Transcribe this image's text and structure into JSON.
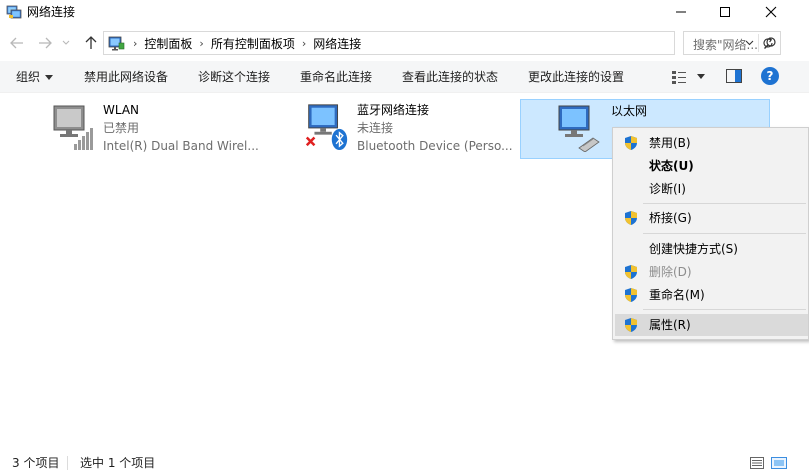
{
  "window": {
    "title": "网络连接"
  },
  "address": {
    "crumbs": [
      "控制面板",
      "所有控制面板项",
      "网络连接"
    ],
    "search_placeholder": "搜索\"网络..."
  },
  "commands": {
    "organize": "组织",
    "disable_device": "禁用此网络设备",
    "diagnose": "诊断这个连接",
    "rename": "重命名此连接",
    "view_status": "查看此连接的状态",
    "change_settings": "更改此连接的设置",
    "help_glyph": "?"
  },
  "connections": [
    {
      "name": "WLAN",
      "status": "已禁用",
      "device": "Intel(R) Dual Band Wirel...",
      "icon": "wifi-adapter-icon"
    },
    {
      "name": "蓝牙网络连接",
      "status": "未连接",
      "device": "Bluetooth Device (Perso...",
      "icon": "bluetooth-adapter-icon"
    },
    {
      "name": "以太网",
      "status": "",
      "device": "",
      "icon": "ethernet-adapter-icon",
      "selected": true
    }
  ],
  "context_menu": [
    {
      "label": "禁用(B)",
      "shield": true
    },
    {
      "label": "状态(U)",
      "shield": false,
      "bold": true
    },
    {
      "label": "诊断(I)",
      "shield": false
    },
    {
      "label": "桥接(G)",
      "shield": true
    },
    {
      "label": "创建快捷方式(S)",
      "shield": false
    },
    {
      "label": "删除(D)",
      "shield": true,
      "disabled": true
    },
    {
      "label": "重命名(M)",
      "shield": true
    },
    {
      "label": "属性(R)",
      "shield": true,
      "hover": true
    }
  ],
  "status_bar": {
    "item_count": "3 个项目",
    "selected_count": "选中 1 个项目"
  },
  "colors": {
    "selection": "#cce8ff",
    "selection_border": "#99d1ff",
    "help": "#1e73d2"
  }
}
